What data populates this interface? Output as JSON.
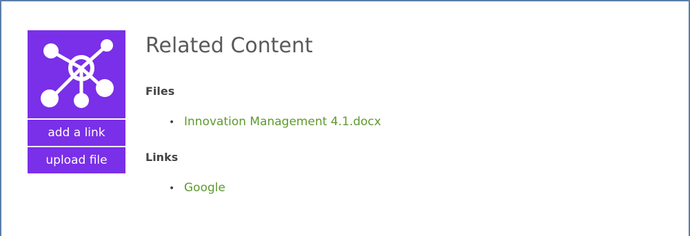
{
  "panel": {
    "title": "Related Content",
    "icon": "network-hub-icon",
    "accent_color": "#7a2fe8",
    "link_color": "#5d9a2e"
  },
  "actions": {
    "add_link_label": "add a link",
    "upload_file_label": "upload file"
  },
  "files": {
    "heading": "Files",
    "items": [
      "Innovation Management 4.1.docx"
    ]
  },
  "links": {
    "heading": "Links",
    "items": [
      "Google"
    ]
  }
}
